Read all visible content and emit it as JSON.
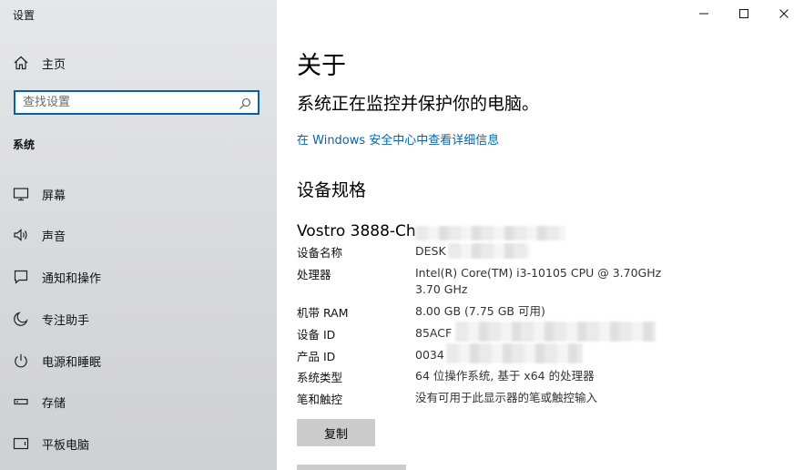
{
  "app": {
    "title": "设置"
  },
  "window_controls": {
    "minimize_icon": "minimize-icon",
    "maximize_icon": "maximize-icon",
    "close_icon": "close-icon"
  },
  "sidebar": {
    "home": {
      "label": "主页",
      "icon": "home-icon"
    },
    "search": {
      "placeholder": "查找设置",
      "icon": "search-icon"
    },
    "section_title": "系统",
    "items": [
      {
        "label": "屏幕",
        "icon": "monitor-icon"
      },
      {
        "label": "声音",
        "icon": "speaker-icon"
      },
      {
        "label": "通知和操作",
        "icon": "message-icon"
      },
      {
        "label": "专注助手",
        "icon": "moon-icon"
      },
      {
        "label": "电源和睡眠",
        "icon": "power-icon"
      },
      {
        "label": "存储",
        "icon": "storage-icon"
      },
      {
        "label": "平板电脑",
        "icon": "tablet-icon"
      }
    ]
  },
  "main": {
    "title": "关于",
    "status": "系统正在监控并保护你的电脑。",
    "security_link": "在 Windows 安全中心中查看详细信息",
    "specs_title": "设备规格",
    "device_model": "Vostro 3888-Ch",
    "specs": [
      {
        "label": "设备名称",
        "value": "DESK"
      },
      {
        "label": "处理器",
        "value": "Intel(R) Core(TM) i3-10105 CPU @ 3.70GHz   3.70 GHz"
      },
      {
        "label": "机带 RAM",
        "value": "8.00 GB (7.75 GB 可用)"
      },
      {
        "label": "设备 ID",
        "value": "85ACF"
      },
      {
        "label": "产品 ID",
        "value": "0034"
      },
      {
        "label": "系统类型",
        "value": "64 位操作系统, 基于 x64 的处理器"
      },
      {
        "label": "笔和触控",
        "value": "没有可用于此显示器的笔或触控输入"
      }
    ],
    "copy_button": "复制"
  },
  "colors": {
    "accent": "#0063b1",
    "link": "#0066b4",
    "button_bg": "#cccccc"
  }
}
